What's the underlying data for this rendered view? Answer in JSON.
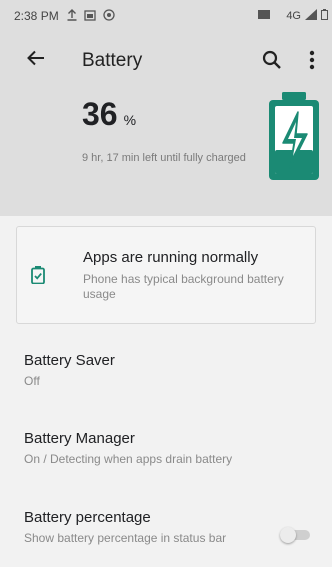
{
  "status_bar": {
    "time": "2:38 PM",
    "notification_icons": [
      "upload-icon",
      "calendar-icon",
      "circle-app-icon"
    ],
    "network_label": "4G",
    "icons": [
      "network-type-icon",
      "signal-icon",
      "battery-status-icon"
    ]
  },
  "toolbar": {
    "title": "Battery",
    "back_icon": "back-arrow-icon",
    "search_icon": "search-icon",
    "more_icon": "more-vert-icon"
  },
  "summary": {
    "level": "36",
    "unit": "%",
    "level_fraction": 0.36,
    "remaining": "9 hr, 17 min left until fully charged",
    "battery_icon": "battery-charging-icon",
    "accent_color": "#1b8a74"
  },
  "status_card": {
    "title": "Apps are running normally",
    "subtitle": "Phone has typical background battery usage",
    "icon": "battery-check-icon",
    "icon_color": "#1b8a74"
  },
  "settings": [
    {
      "title": "Battery Saver",
      "subtitle": "Off"
    },
    {
      "title": "Battery Manager",
      "subtitle": "On / Detecting when apps drain battery"
    },
    {
      "title": "Battery percentage",
      "subtitle": "Show battery percentage in status bar",
      "toggle_on": false
    }
  ]
}
